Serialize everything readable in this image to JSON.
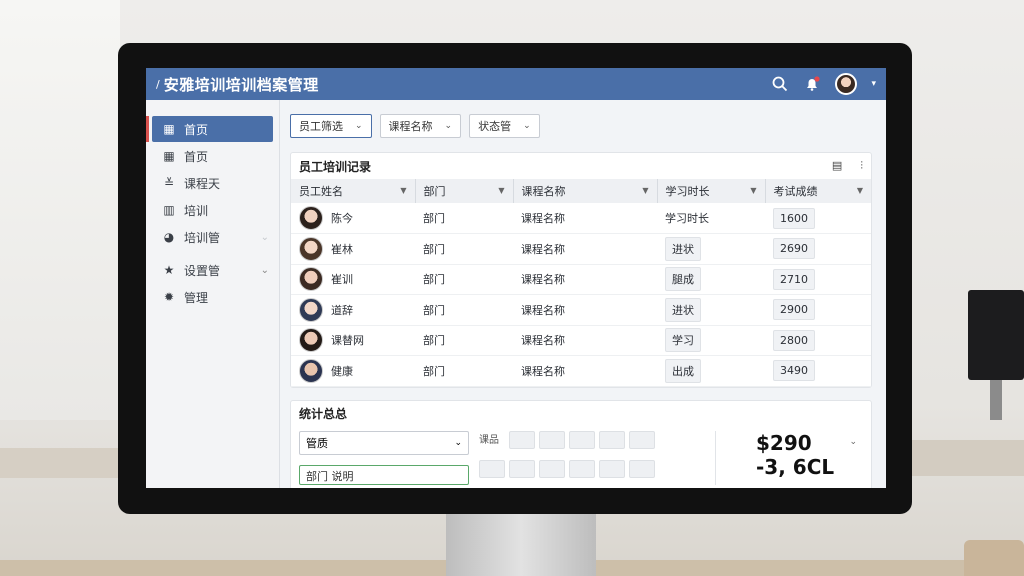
{
  "app": {
    "title": "安雅培训培训档案管理"
  },
  "sidebar": {
    "items": [
      {
        "label": "首页",
        "icon": "dashboard-icon"
      },
      {
        "label": "首页",
        "icon": "grid-icon"
      },
      {
        "label": "课程天",
        "icon": "book-icon"
      },
      {
        "label": "培训",
        "icon": "chart-icon"
      },
      {
        "label": "培训管",
        "icon": "pie-icon"
      },
      {
        "label": "设置管",
        "icon": "star-icon"
      },
      {
        "label": "管理",
        "icon": "gear-icon"
      }
    ]
  },
  "filters": {
    "employee": "员工筛选",
    "course": "课程名称",
    "status": "状态管"
  },
  "records": {
    "title": "员工培训记录",
    "columns": [
      "员工姓名",
      "部门",
      "课程名称",
      "学习时长",
      "考试成绩"
    ],
    "rows": [
      {
        "name": "陈今",
        "dept": "部门",
        "course": "课程名称",
        "duration": "学习时长",
        "score": "1600"
      },
      {
        "name": "崔林",
        "dept": "部门",
        "course": "课程名称",
        "duration": "进状",
        "score": "2690"
      },
      {
        "name": "崔训",
        "dept": "部门",
        "course": "课程名称",
        "duration": "腿成",
        "score": "2710"
      },
      {
        "name": "道辞",
        "dept": "部门",
        "course": "课程名称",
        "duration": "进状",
        "score": "2900"
      },
      {
        "name": "课替网",
        "dept": "部门",
        "course": "课程名称",
        "duration": "学习",
        "score": "2800"
      },
      {
        "name": "健康",
        "dept": "部门",
        "course": "课程名称",
        "duration": "出成",
        "score": "3490"
      }
    ]
  },
  "summary": {
    "title": "统计总总",
    "select": "管质",
    "green_field": "部门 说明",
    "keys_label": "课品",
    "stat_primary": "$290",
    "stat_secondary": "-3, 6CL"
  },
  "colors": {
    "header": "#4a6fa8",
    "accent_red": "#d9534f",
    "highlight_green": "#5aa86a"
  }
}
